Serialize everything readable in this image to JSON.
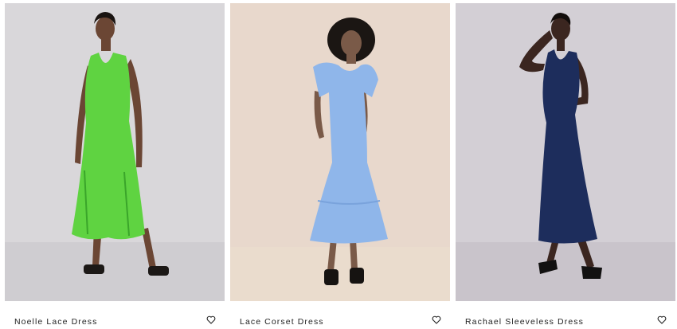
{
  "products": [
    {
      "name": "Noelle Lace Dress",
      "dress_color": "#5fd341",
      "background": "#d9d7da",
      "floor": "#cfcdd1",
      "skin": "#6b4634",
      "hair": "#1a1411",
      "shoes": "#1c1816",
      "wishlist_icon": "heart-outline-icon"
    },
    {
      "name": "Lace Corset Dress",
      "dress_color": "#8fb6ea",
      "background": "#e8d8cc",
      "floor": "#eadccd",
      "skin": "#7a5a48",
      "hair": "#1b1613",
      "shoes": "#161311",
      "wishlist_icon": "heart-outline-icon"
    },
    {
      "name": "Rachael Sleeveless Dress",
      "dress_color": "#1d2d5c",
      "background": "#d3cfd5",
      "floor": "#c9c4cb",
      "skin": "#3b2620",
      "hair": "#120d0b",
      "shoes": "#121111",
      "wishlist_icon": "heart-outline-icon"
    }
  ]
}
